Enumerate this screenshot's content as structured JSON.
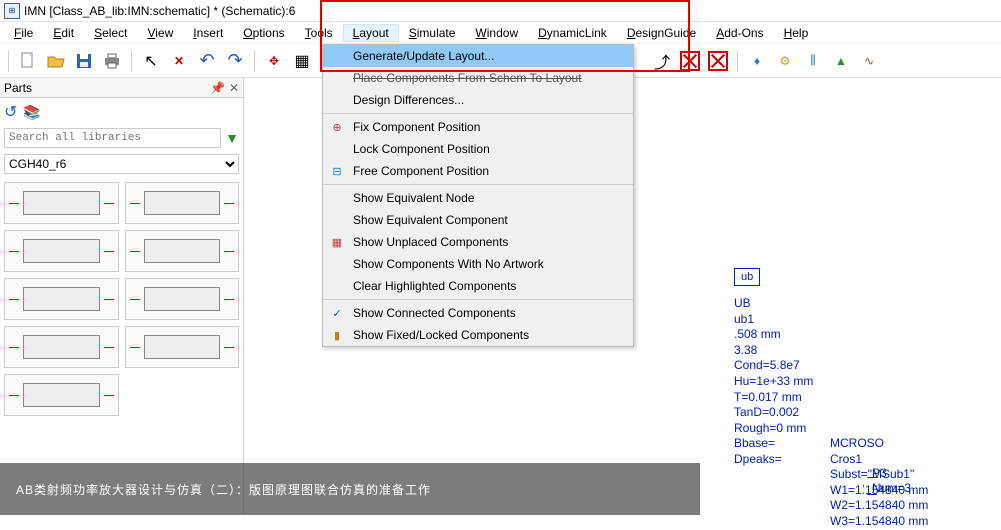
{
  "title": "IMN [Class_AB_lib:IMN:schematic] * (Schematic):6",
  "menubar": [
    "File",
    "Edit",
    "Select",
    "View",
    "Insert",
    "Options",
    "Tools",
    "Layout",
    "Simulate",
    "Window",
    "DynamicLink",
    "DesignGuide",
    "Add-Ons",
    "Help"
  ],
  "menubar_open_index": 7,
  "sidebar": {
    "title": "Parts",
    "search_placeholder": "Search all libraries",
    "library": "CGH40_r6"
  },
  "dropdown": {
    "items": [
      {
        "label": "Generate/Update Layout...",
        "selected": true
      },
      {
        "label": "Place Components From Schem To Layout",
        "strike": true
      },
      {
        "label": "Design Differences..."
      },
      {
        "sep": true
      },
      {
        "label": "Fix Component Position",
        "icon": "fix"
      },
      {
        "label": "Lock Component Position"
      },
      {
        "label": "Free Component Position",
        "icon": "free"
      },
      {
        "sep": true
      },
      {
        "label": "Show Equivalent Node"
      },
      {
        "label": "Show Equivalent Component"
      },
      {
        "label": "Show Unplaced Components",
        "icon": "unplaced"
      },
      {
        "label": "Show Components With No Artwork"
      },
      {
        "label": "Clear Highlighted Components"
      },
      {
        "sep": true
      },
      {
        "label": "Show Connected Components",
        "icon": "check"
      },
      {
        "label": "Show Fixed/Locked Components",
        "icon": "locked"
      }
    ]
  },
  "schematic": {
    "box_label": "ub",
    "lines": [
      "UB",
      "ub1",
      ".508 mm",
      "3.38",
      "",
      "Cond=5.8e7",
      "Hu=1e+33 mm",
      "T=0.017 mm",
      "TanD=0.002",
      "Rough=0 mm",
      "Bbase=",
      "Dpeaks="
    ],
    "right_block": [
      "MCROSO",
      "Cros1",
      "Subst=\"MSub1\"",
      "W1=1.154840 mm",
      "W2=1.154840 mm",
      "W3=1.154840 mm"
    ],
    "port": {
      "name": "P3",
      "num": "Num=3"
    }
  },
  "caption": "AB类射频功率放大器设计与仿真（二）：版图原理图联合仿真的准备工作"
}
